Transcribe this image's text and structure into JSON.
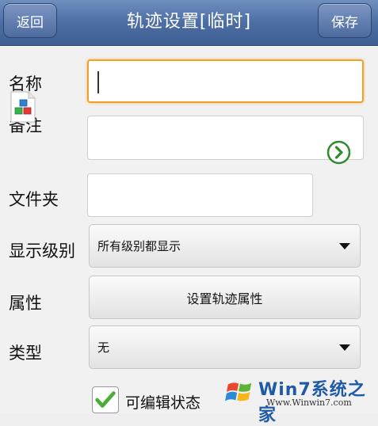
{
  "header": {
    "back_label": "返回",
    "title": "轨迹设置[临时]",
    "save_label": "保存"
  },
  "form": {
    "name": {
      "label": "名称",
      "value": ""
    },
    "note": {
      "label": "备注",
      "value": ""
    },
    "folder": {
      "label": "文件夹",
      "value": ""
    },
    "display_level": {
      "label": "显示级别",
      "selected": "所有级别都显示"
    },
    "attributes": {
      "label": "属性",
      "button_label": "设置轨迹属性"
    },
    "type": {
      "label": "类型",
      "selected": "无"
    },
    "editable": {
      "label": "可编辑状态",
      "checked": true
    }
  },
  "icons": {
    "note_icon": "note-blocks-icon",
    "folder_go": "arrow-right-circle-icon",
    "dropdown": "triangle-down-icon",
    "check": "checkmark-icon"
  },
  "colors": {
    "header": "#4d6ea3",
    "focus": "#f0a12a",
    "go_icon": "#2f8b2f",
    "check": "#4cae3a"
  },
  "watermark": {
    "brand": "Win7系统之家",
    "url": "Www.Winwin7.com"
  }
}
